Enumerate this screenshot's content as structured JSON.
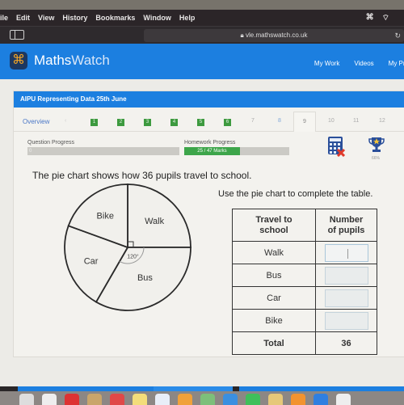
{
  "menubar": {
    "items": [
      "ile",
      "Edit",
      "View",
      "History",
      "Bookmarks",
      "Window",
      "Help"
    ]
  },
  "browser": {
    "url": "vle.mathswatch.co.uk",
    "lock_icon": "lock-icon",
    "reload_icon": "reload-icon"
  },
  "site": {
    "brand_main": "Maths",
    "brand_accent": "Watch",
    "nav": [
      "My Work",
      "Videos",
      "My Pro"
    ],
    "accent_color": "#1c7fe0"
  },
  "assignment": {
    "title": "AIPU Representing Data 25th June",
    "tabs": {
      "overview": "Overview",
      "completed": [
        "1",
        "2",
        "3",
        "4",
        "5",
        "6"
      ],
      "pending": [
        "7",
        "8"
      ],
      "current": "9",
      "upcoming": [
        "10",
        "11",
        "12"
      ]
    },
    "question_progress_label": "Question Progress",
    "question_progress_value": "0",
    "question_progress_fraction": 0,
    "homework_progress_label": "Homework Progress",
    "homework_progress_text": "25 / 47 Marks",
    "homework_progress_fraction": 0.53,
    "trophy_percent": "66%"
  },
  "question": {
    "text": "The pie chart shows how 36 pupils travel to school.",
    "instruction": "Use the pie chart to complete the table.",
    "angle_label": "120°"
  },
  "table": {
    "headers": [
      "Travel to school",
      "Number of pupils"
    ],
    "header1_line1": "Travel to",
    "header1_line2": "school",
    "header2_line1": "Number",
    "header2_line2": "of pupils",
    "rows": [
      {
        "label": "Walk",
        "value": ""
      },
      {
        "label": "Bus",
        "value": ""
      },
      {
        "label": "Car",
        "value": ""
      },
      {
        "label": "Bike",
        "value": ""
      }
    ],
    "total_label": "Total",
    "total_value": "36"
  },
  "chart_data": {
    "type": "pie",
    "title": "How 36 pupils travel to school",
    "total": 36,
    "categories": [
      "Walk",
      "Bus",
      "Car",
      "Bike"
    ],
    "angles_degrees": [
      90,
      120,
      80,
      70
    ],
    "annotations": [
      "right angle marker on Walk",
      "120° on Bus"
    ]
  }
}
